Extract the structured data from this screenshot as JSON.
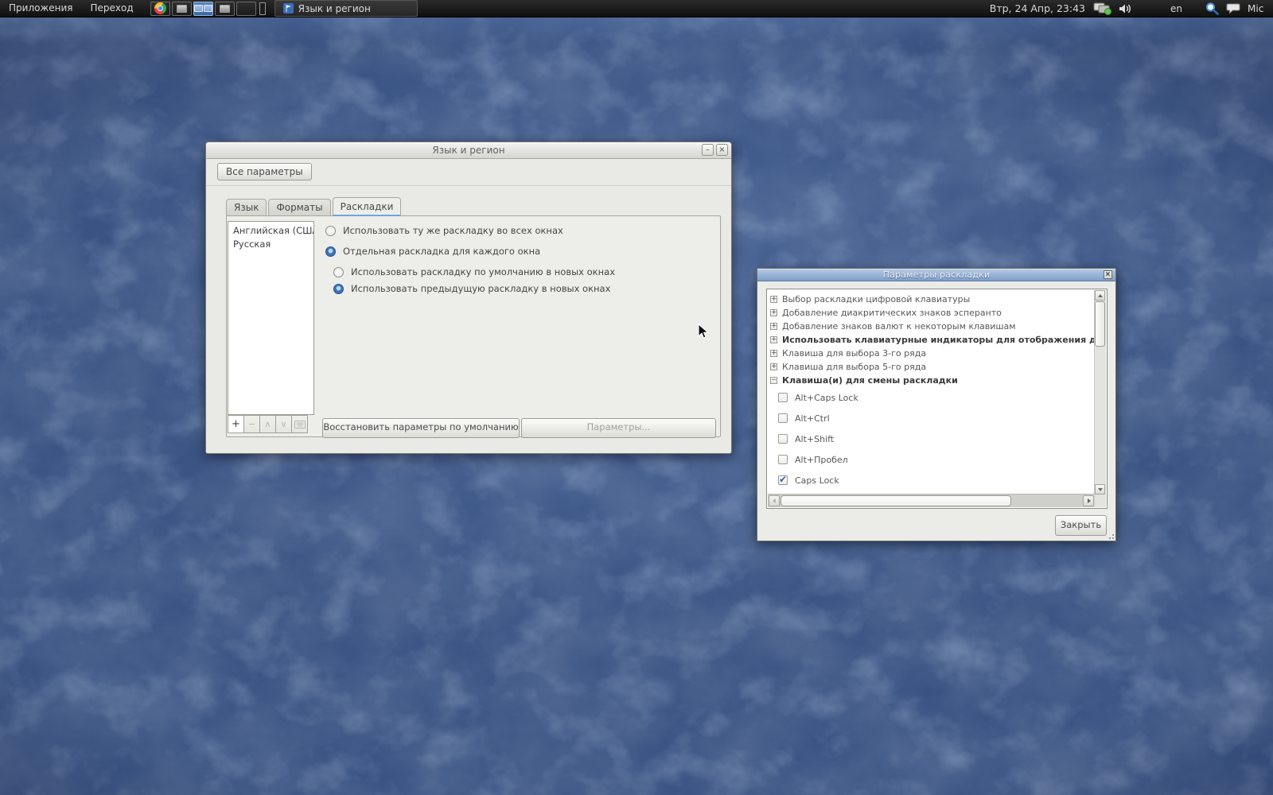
{
  "colors": {
    "accent_blue": "#3a72b4",
    "titlebar_blue": "#7e9eca",
    "panel_bg": "#1a1a1a",
    "window_bg": "#e9e9e6"
  },
  "panel": {
    "menus": [
      {
        "label": "Приложения"
      },
      {
        "label": "Переход"
      }
    ],
    "taskbar": {
      "active_window": "Язык и регион"
    },
    "clock": "Втр, 24 Апр, 23:43",
    "keyboard_indicator": "en",
    "tray_text": "Mic"
  },
  "region_window": {
    "title": "Язык и регион",
    "window_controls": {
      "minimize": "–",
      "close": "×"
    },
    "toolbar": {
      "all_settings": "Все параметры"
    },
    "tabs": [
      {
        "label": "Язык",
        "active": false
      },
      {
        "label": "Форматы",
        "active": false
      },
      {
        "label": "Раскладки",
        "active": true
      }
    ],
    "layouts": [
      "Английская (США)",
      "Русская"
    ],
    "list_toolbar": {
      "add": {
        "glyph": "+",
        "disabled": false
      },
      "remove": {
        "glyph": "−",
        "disabled": true
      },
      "move_up": {
        "glyph": "∧",
        "disabled": true
      },
      "move_down": {
        "glyph": "∨",
        "disabled": true
      },
      "preview": {
        "disabled": true
      }
    },
    "options": [
      {
        "label": "Использовать ту же раскладку во всех окнах",
        "selected": false,
        "indent": false
      },
      {
        "label": "Отдельная раскладка для каждого окна",
        "selected": true,
        "indent": false
      },
      {
        "label": "Использовать раскладку по умолчанию в новых окнах",
        "selected": false,
        "indent": true
      },
      {
        "label": "Использовать предыдущую раскладку в новых окнах",
        "selected": true,
        "indent": true
      }
    ],
    "buttons": {
      "restore": "Восстановить параметры по умолчанию",
      "options": "Параметры...",
      "options_disabled": true
    }
  },
  "layout_options_window": {
    "title": "Параметры раскладки",
    "window_controls": {
      "close": "×"
    },
    "tree": [
      {
        "label": "Выбор раскладки цифровой клавиатуры",
        "expander": "+",
        "bold": false
      },
      {
        "label": "Добавление диакритических знаков эсперанто",
        "expander": "+",
        "bold": false
      },
      {
        "label": "Добавление знаков валют к некоторым клавишам",
        "expander": "+",
        "bold": false
      },
      {
        "label": "Использовать клавиатурные индикаторы для отображения до",
        "expander": "+",
        "bold": true
      },
      {
        "label": "Клавиша для выбора 3-го ряда",
        "expander": "+",
        "bold": false
      },
      {
        "label": "Клавиша для выбора 5-го ряда",
        "expander": "+",
        "bold": false
      },
      {
        "label": "Клавиша(и) для смены раскладки",
        "expander": "−",
        "bold": true
      }
    ],
    "switch_options": [
      {
        "label": "Alt+Caps Lock",
        "checked": false
      },
      {
        "label": "Alt+Ctrl",
        "checked": false
      },
      {
        "label": "Alt+Shift",
        "checked": false
      },
      {
        "label": "Alt+Пробел",
        "checked": false
      },
      {
        "label": "Caps Lock",
        "checked": true
      }
    ],
    "close_button": "Закрыть"
  }
}
